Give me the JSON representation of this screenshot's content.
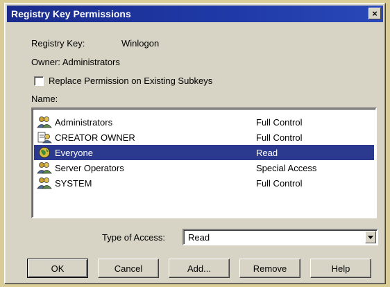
{
  "window": {
    "title": "Registry Key Permissions",
    "close_label": "×"
  },
  "registry_key": {
    "label": "Registry Key:",
    "value": "Winlogon"
  },
  "owner": {
    "label": "Owner:",
    "value": "Administrators"
  },
  "replace_checkbox": {
    "label": "Replace Permission on Existing Subkeys",
    "checked": false
  },
  "name_label": "Name:",
  "entries": [
    {
      "name": "Administrators",
      "permission": "Full Control",
      "icon": "group-icon",
      "selected": false
    },
    {
      "name": "CREATOR OWNER",
      "permission": "Full Control",
      "icon": "creator-owner-icon",
      "selected": false
    },
    {
      "name": "Everyone",
      "permission": "Read",
      "icon": "globe-icon",
      "selected": true
    },
    {
      "name": "Server Operators",
      "permission": "Special Access",
      "icon": "group-icon",
      "selected": false
    },
    {
      "name": "SYSTEM",
      "permission": "Full Control",
      "icon": "group-icon",
      "selected": false
    }
  ],
  "type_of_access": {
    "label": "Type of Access:",
    "value": "Read"
  },
  "buttons": {
    "ok": "OK",
    "cancel": "Cancel",
    "add": "Add...",
    "remove": "Remove",
    "help": "Help"
  },
  "colors": {
    "title_bar": "#1f3aa8",
    "selection": "#2b3a8f",
    "dialog_face": "#d7d3c5",
    "desktop": "#d9cc96"
  }
}
